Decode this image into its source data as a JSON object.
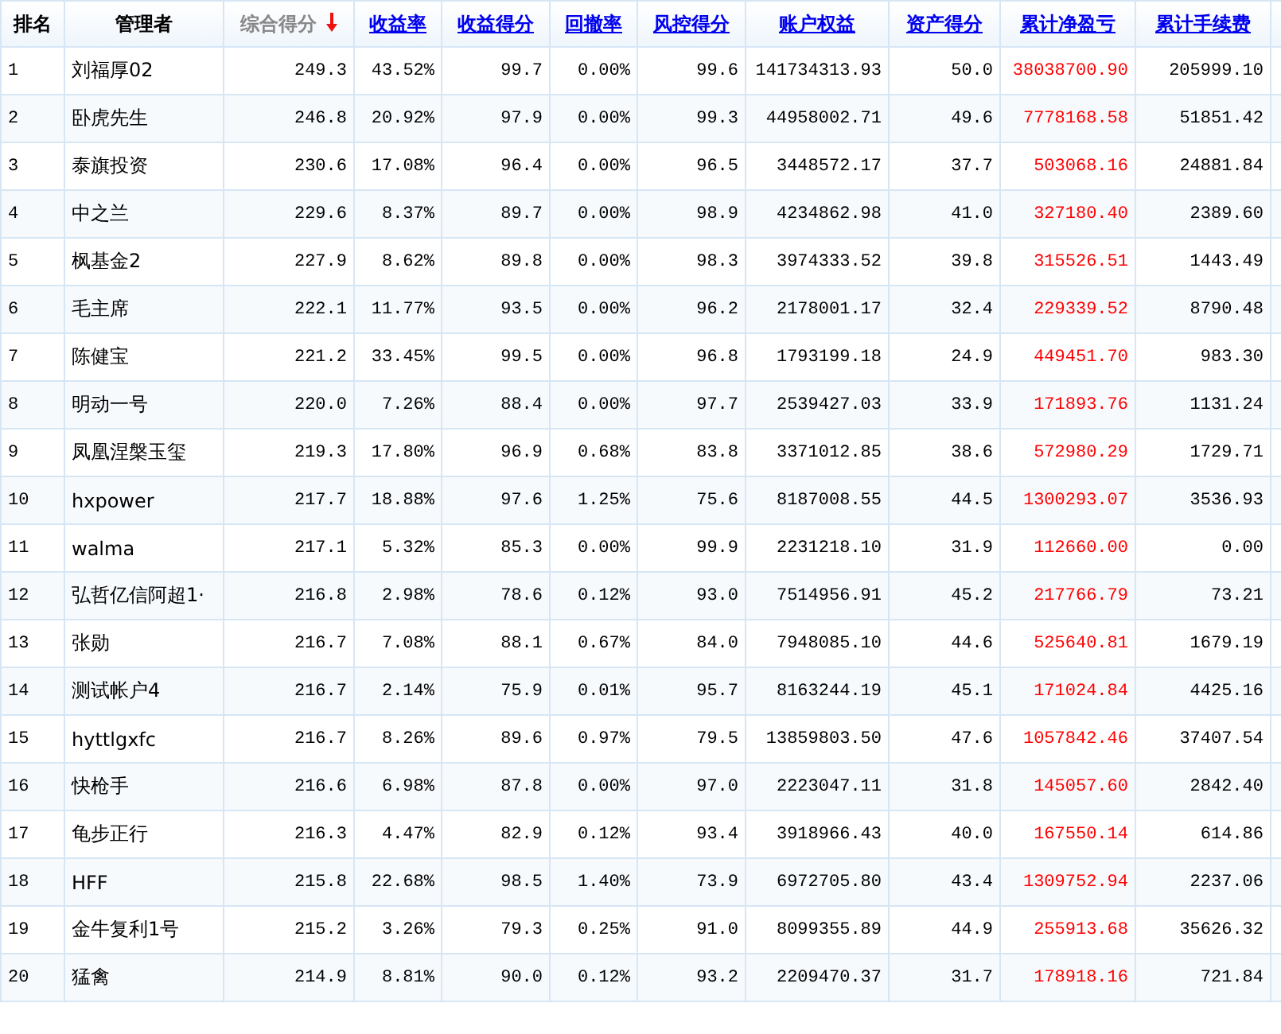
{
  "table": {
    "columns": [
      {
        "label": "排名",
        "kind": "plain",
        "sorted": false,
        "highlight": false
      },
      {
        "label": "管理者",
        "kind": "plain",
        "sorted": false,
        "highlight": false
      },
      {
        "label": "综合得分",
        "kind": "plain",
        "sorted": true,
        "highlight": false
      },
      {
        "label": "收益率",
        "kind": "link",
        "sorted": false,
        "highlight": false
      },
      {
        "label": "收益得分",
        "kind": "link",
        "sorted": false,
        "highlight": false
      },
      {
        "label": "回撤率",
        "kind": "link",
        "sorted": false,
        "highlight": false
      },
      {
        "label": "风控得分",
        "kind": "link",
        "sorted": false,
        "highlight": false
      },
      {
        "label": "账户权益",
        "kind": "link",
        "sorted": false,
        "highlight": false
      },
      {
        "label": "资产得分",
        "kind": "link",
        "sorted": false,
        "highlight": false
      },
      {
        "label": "累计净盈亏",
        "kind": "link",
        "sorted": false,
        "highlight": true
      },
      {
        "label": "累计手续费",
        "kind": "link",
        "sorted": false,
        "highlight": false
      }
    ],
    "rows": [
      [
        "1",
        "刘福厚02",
        "249.3",
        "43.52%",
        "99.7",
        "0.00%",
        "99.6",
        "141734313.93",
        "50.0",
        "38038700.90",
        "205999.10"
      ],
      [
        "2",
        "卧虎先生",
        "246.8",
        "20.92%",
        "97.9",
        "0.00%",
        "99.3",
        "44958002.71",
        "49.6",
        "7778168.58",
        "51851.42"
      ],
      [
        "3",
        "泰旗投资",
        "230.6",
        "17.08%",
        "96.4",
        "0.00%",
        "96.5",
        "3448572.17",
        "37.7",
        "503068.16",
        "24881.84"
      ],
      [
        "4",
        "中之兰",
        "229.6",
        "8.37%",
        "89.7",
        "0.00%",
        "98.9",
        "4234862.98",
        "41.0",
        "327180.40",
        "2389.60"
      ],
      [
        "5",
        "枫基金2",
        "227.9",
        "8.62%",
        "89.8",
        "0.00%",
        "98.3",
        "3974333.52",
        "39.8",
        "315526.51",
        "1443.49"
      ],
      [
        "6",
        "毛主席",
        "222.1",
        "11.77%",
        "93.5",
        "0.00%",
        "96.2",
        "2178001.17",
        "32.4",
        "229339.52",
        "8790.48"
      ],
      [
        "7",
        "陈健宝",
        "221.2",
        "33.45%",
        "99.5",
        "0.00%",
        "96.8",
        "1793199.18",
        "24.9",
        "449451.70",
        "983.30"
      ],
      [
        "8",
        "明动一号",
        "220.0",
        "7.26%",
        "88.4",
        "0.00%",
        "97.7",
        "2539427.03",
        "33.9",
        "171893.76",
        "1131.24"
      ],
      [
        "9",
        "凤凰涅槃玉玺",
        "219.3",
        "17.80%",
        "96.9",
        "0.68%",
        "83.8",
        "3371012.85",
        "38.6",
        "572980.29",
        "1729.71"
      ],
      [
        "10",
        "hxpower",
        "217.7",
        "18.88%",
        "97.6",
        "1.25%",
        "75.6",
        "8187008.55",
        "44.5",
        "1300293.07",
        "3536.93"
      ],
      [
        "11",
        "walma",
        "217.1",
        "5.32%",
        "85.3",
        "0.00%",
        "99.9",
        "2231218.10",
        "31.9",
        "112660.00",
        "0.00"
      ],
      [
        "12",
        "弘哲亿信阿超1·",
        "216.8",
        "2.98%",
        "78.6",
        "0.12%",
        "93.0",
        "7514956.91",
        "45.2",
        "217766.79",
        "73.21"
      ],
      [
        "13",
        "张勋",
        "216.7",
        "7.08%",
        "88.1",
        "0.67%",
        "84.0",
        "7948085.10",
        "44.6",
        "525640.81",
        "1679.19"
      ],
      [
        "14",
        "测试帐户4",
        "216.7",
        "2.14%",
        "75.9",
        "0.01%",
        "95.7",
        "8163244.19",
        "45.1",
        "171024.84",
        "4425.16"
      ],
      [
        "15",
        "hyttlgxfc",
        "216.7",
        "8.26%",
        "89.6",
        "0.97%",
        "79.5",
        "13859803.50",
        "47.6",
        "1057842.46",
        "37407.54"
      ],
      [
        "16",
        "快枪手",
        "216.6",
        "6.98%",
        "87.8",
        "0.00%",
        "97.0",
        "2223047.11",
        "31.8",
        "145057.60",
        "2842.40"
      ],
      [
        "17",
        "龟步正行",
        "216.3",
        "4.47%",
        "82.9",
        "0.12%",
        "93.4",
        "3918966.43",
        "40.0",
        "167550.14",
        "614.86"
      ],
      [
        "18",
        "HFF",
        "215.8",
        "22.68%",
        "98.5",
        "1.40%",
        "73.9",
        "6972705.80",
        "43.4",
        "1309752.94",
        "2237.06"
      ],
      [
        "19",
        "金牛复利1号",
        "215.2",
        "3.26%",
        "79.3",
        "0.25%",
        "91.0",
        "8099355.89",
        "44.9",
        "255913.68",
        "35626.32"
      ],
      [
        "20",
        "猛禽",
        "214.9",
        "8.81%",
        "90.0",
        "0.12%",
        "93.2",
        "2209470.37",
        "31.7",
        "178918.16",
        "721.84"
      ]
    ]
  }
}
